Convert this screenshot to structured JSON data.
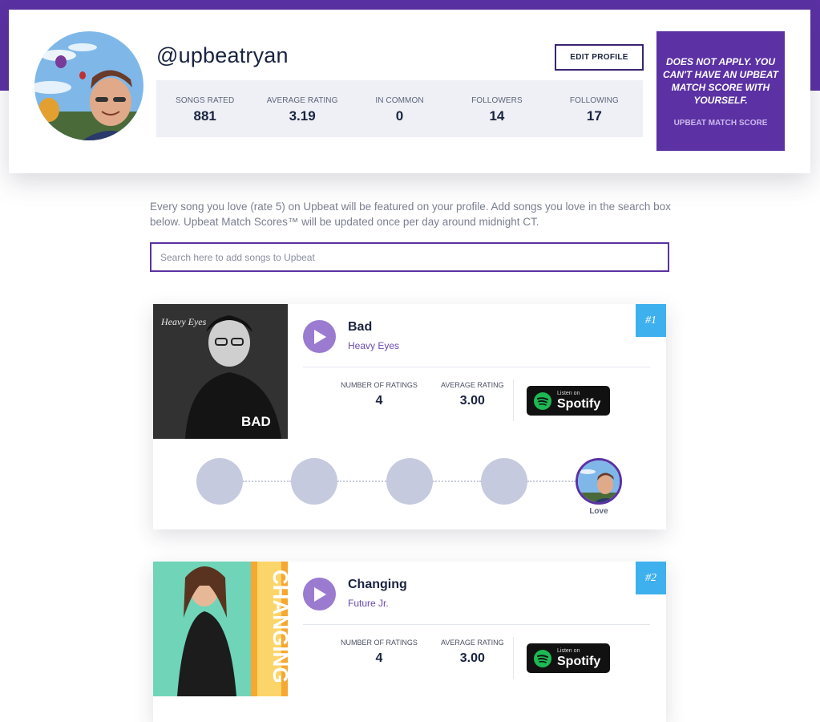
{
  "profile": {
    "handle": "@upbeatryan",
    "edit_label": "EDIT PROFILE",
    "stats": [
      {
        "label": "SONGS RATED",
        "value": "881"
      },
      {
        "label": "AVERAGE RATING",
        "value": "3.19"
      },
      {
        "label": "IN COMMON",
        "value": "0"
      },
      {
        "label": "FOLLOWERS",
        "value": "14"
      },
      {
        "label": "FOLLOWING",
        "value": "17"
      }
    ],
    "match_text": "DOES NOT APPLY. YOU CAN'T HAVE AN UPBEAT MATCH SCORE WITH YOURSELF.",
    "match_label": "UPBEAT MATCH SCORE"
  },
  "intro": "Every song you love (rate 5) on Upbeat will be featured on your profile. Add songs you love in the search box below. Upbeat Match Scores™ will be updated once per day around midnight CT.",
  "search": {
    "placeholder": "Search here to add songs to Upbeat"
  },
  "songs": [
    {
      "rank": "#1",
      "title": "Bad",
      "artist": "Heavy Eyes",
      "cover_text": "BAD",
      "cover_script": "Heavy Eyes",
      "num_ratings_label": "NUMBER OF RATINGS",
      "num_ratings": "4",
      "avg_rating_label": "AVERAGE RATING",
      "avg_rating": "3.00",
      "spotify_small": "Listen on",
      "spotify_big": "Spotify",
      "love_label": "Love"
    },
    {
      "rank": "#2",
      "title": "Changing",
      "artist": "Future Jr.",
      "cover_text": "CHANGING",
      "num_ratings_label": "NUMBER OF RATINGS",
      "num_ratings": "4",
      "avg_rating_label": "AVERAGE RATING",
      "avg_rating": "3.00",
      "spotify_small": "Listen on",
      "spotify_big": "Spotify"
    }
  ],
  "colors": {
    "brand_purple": "#5b31a3",
    "rank_blue": "#3fb0ee",
    "play_purple": "#9a7bd0"
  }
}
